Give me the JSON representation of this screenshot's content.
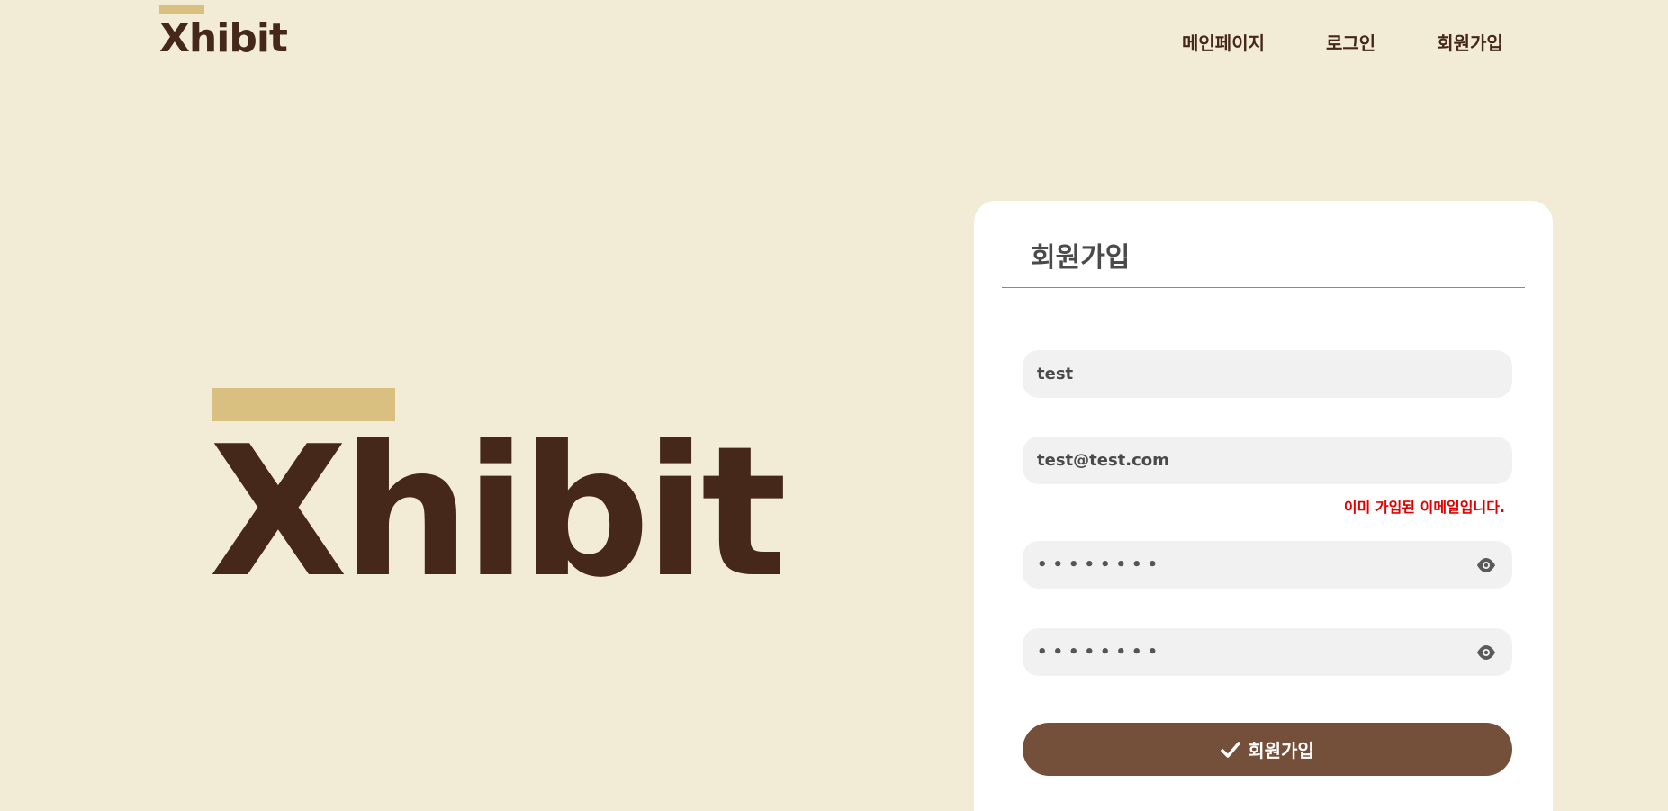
{
  "header": {
    "logo_text": "Xhibit",
    "nav": [
      "메인페이지",
      "로그인",
      "회원가입"
    ]
  },
  "hero": {
    "logo_text": "Xhibit"
  },
  "form": {
    "title": "회원가입",
    "username_value": "test",
    "email_value": "test@test.com",
    "email_error": "이미 가입된 이메일입니다.",
    "password_dots": "••••••••",
    "password_confirm_dots": "••••••••",
    "submit_label": "회원가입",
    "submit_icon": "check-icon",
    "password_icon": "eye-icon"
  },
  "colors": {
    "background": "#f2ecd7",
    "brand_dark": "#45281a",
    "accent_bar": "#d9bf80",
    "button": "#74503a",
    "error": "#e00000",
    "field_bg": "#f1f1f1"
  }
}
